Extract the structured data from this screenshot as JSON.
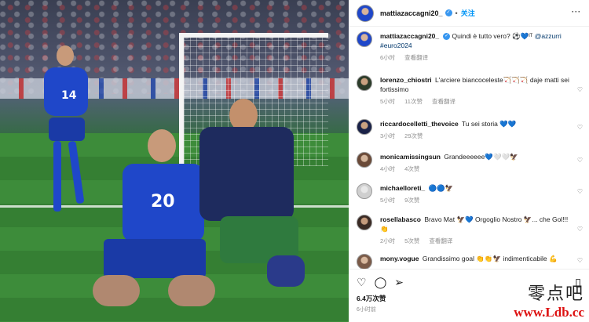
{
  "header": {
    "username": "mattiazaccagni20_",
    "follow_label": "关注",
    "separator": "•",
    "menu_icon": "more-icon"
  },
  "photo": {
    "player1_number": "14",
    "player2_number": "20"
  },
  "caption": {
    "username": "mattiazaccagni20_",
    "text": "Quindi è tutto vero? ⚽💙ᴵᵀ",
    "mention": "@azzurri",
    "hashtag": "#euro2024",
    "time": "6小时",
    "translate": "查看翻译"
  },
  "comments": [
    {
      "username": "lorenzo_chiostri",
      "text": "L'arciere biancoceleste🏹🏹🏹 daje matti sei fortissimo",
      "time": "5小时",
      "likes": "11次赞",
      "reply": "查看翻译"
    },
    {
      "username": "riccardocelletti_thevoice",
      "text": "Tu sei storia 💙💙",
      "time": "3小时",
      "likes": "29次赞",
      "reply": ""
    },
    {
      "username": "monicamissingsun",
      "text": "Grandeeeeee💙🤍🤍🦅",
      "time": "4小时",
      "likes": "4次赞",
      "reply": ""
    },
    {
      "username": "michaelloreti_",
      "text": "🔵🔵🦅",
      "time": "5小时",
      "likes": "9次赞",
      "reply": ""
    },
    {
      "username": "rosellabasco",
      "text": "Bravo Mat 🦅💙 Orgoglio Nostro 🦅... che Gol!!! 👏",
      "time": "2小时",
      "likes": "5次赞",
      "reply": "查看翻译"
    },
    {
      "username": "mony.vogue",
      "text": "Grandissimo goal 👏👏🦅 indimenticabile 💪",
      "time": "",
      "likes": "",
      "reply": ""
    }
  ],
  "footer": {
    "likes": "6.4万次赞",
    "time": "6小时前"
  },
  "watermark": {
    "chinese": "零点吧",
    "url": "www.Ldb.cc"
  },
  "colors": {
    "follow_blue": "#0095f6",
    "verified_blue": "#3897f0",
    "italy_blue": "#1f47c9"
  }
}
